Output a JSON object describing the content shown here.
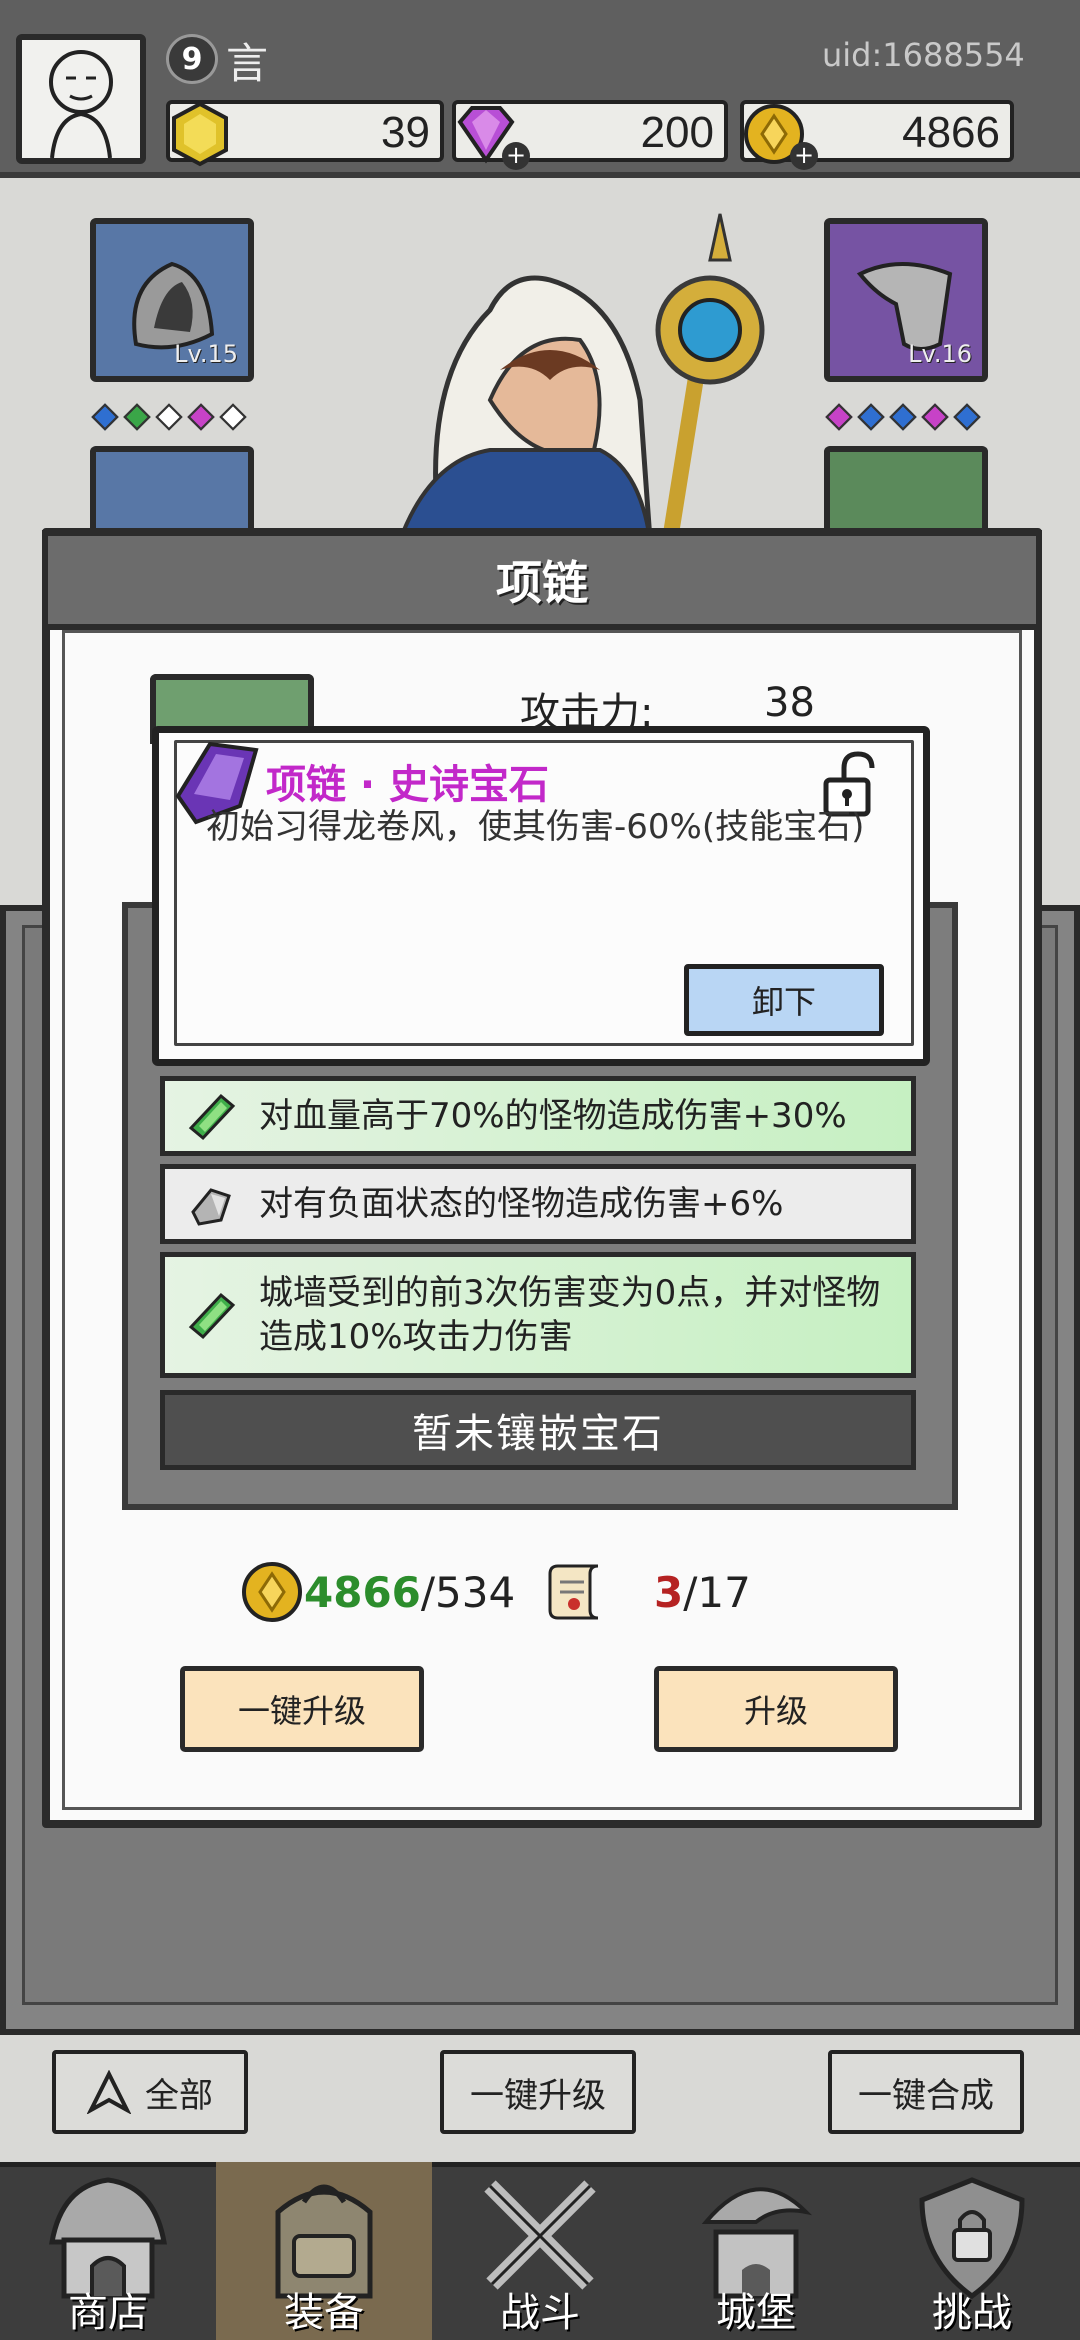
{
  "player": {
    "level": "9",
    "name": "言",
    "uid": "uid:1688554"
  },
  "resources": [
    {
      "name": "energy",
      "value": "39",
      "icon": "hexagon-gem-icon",
      "color": "#e0c22a"
    },
    {
      "name": "diamonds",
      "value": "200",
      "icon": "diamond-icon",
      "color": "#b84fd6"
    },
    {
      "name": "gold",
      "value": "4866",
      "icon": "gold-coin-icon",
      "color": "#e3b320"
    }
  ],
  "equipment": {
    "helmet": {
      "level": "Lv.15",
      "gems": [
        "#2f6fd1",
        "#3aa648",
        "#ffffff",
        "#c742c7",
        "#ffffff"
      ]
    },
    "gloves": {
      "level": "Lv.16",
      "gems": [
        "#c742c7",
        "#2f6fd1",
        "#2f6fd1",
        "#c742c7",
        "#2f6fd1"
      ]
    }
  },
  "modal": {
    "title": "项链",
    "stat_label": "攻击力:",
    "stat_value": "38",
    "affixes": [
      {
        "text": "对血量高于70%的怪物造成伤害+30%",
        "rarity": "green"
      },
      {
        "text": "对有负面状态的怪物造成伤害+6%",
        "rarity": "gray"
      },
      {
        "text": "城墙受到的前3次伤害变为0点，并对怪物造成10%攻击力伤害",
        "rarity": "green"
      }
    ],
    "no_gem_label": "暂未镶嵌宝石",
    "gold_have": "4866",
    "gold_need": "/534",
    "scroll_have": "3",
    "scroll_need": "/17",
    "one_key_upgrade": "一键升级",
    "upgrade": "升级"
  },
  "tooltip": {
    "title": "项链 · 史诗宝石",
    "description": "初始习得龙卷风，使其伤害-60%(技能宝石)",
    "unequip": "卸下"
  },
  "filter_bar": {
    "all": "全部",
    "one_key_upgrade": "一键升级",
    "one_key_merge": "一键合成"
  },
  "nav": [
    {
      "label": "商店",
      "icon": "shop-hut-icon",
      "active": false
    },
    {
      "label": "装备",
      "icon": "backpack-icon",
      "active": true
    },
    {
      "label": "战斗",
      "icon": "crossed-swords-icon",
      "active": false
    },
    {
      "label": "城堡",
      "icon": "castle-tower-icon",
      "active": false
    },
    {
      "label": "挑战",
      "icon": "locked-shield-icon",
      "active": false
    }
  ]
}
